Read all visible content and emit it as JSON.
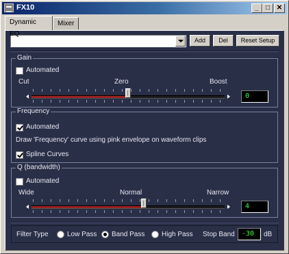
{
  "window": {
    "title": "FX10"
  },
  "tabs": [
    {
      "label": "Dynamic EQ"
    },
    {
      "label": "Mixer"
    }
  ],
  "toolbar": {
    "add_label": "Add",
    "del_label": "Del",
    "reset_label": "Reset Setup"
  },
  "gain": {
    "group_label": "Gain",
    "automated_label": "Automated",
    "automated": false,
    "cut_label": "Cut",
    "zero_label": "Zero",
    "boost_label": "Boost",
    "value": "0",
    "level": 0.5
  },
  "frequency": {
    "group_label": "Frequency",
    "automated_label": "Automated",
    "automated": true,
    "description": "Draw 'Frequency' curve using pink envelope on waveform clips",
    "spline_label": "Spline Curves",
    "spline": true
  },
  "q": {
    "group_label": "Q (bandwidth)",
    "automated_label": "Automated",
    "automated": false,
    "wide_label": "Wide",
    "normal_label": "Normal",
    "narrow_label": "Narrow",
    "value": "4",
    "level": 0.58
  },
  "filter": {
    "type_label": "Filter Type",
    "options": [
      "Low Pass",
      "Band Pass",
      "High Pass"
    ],
    "selected": "Band Pass",
    "stop_band_label": "Stop Band",
    "stop_band_value": "-30",
    "unit": "dB"
  },
  "colors": {
    "panel": "#2a2f48",
    "slider_fill": "#9a1f1f",
    "value_text": "#3cff3c"
  }
}
